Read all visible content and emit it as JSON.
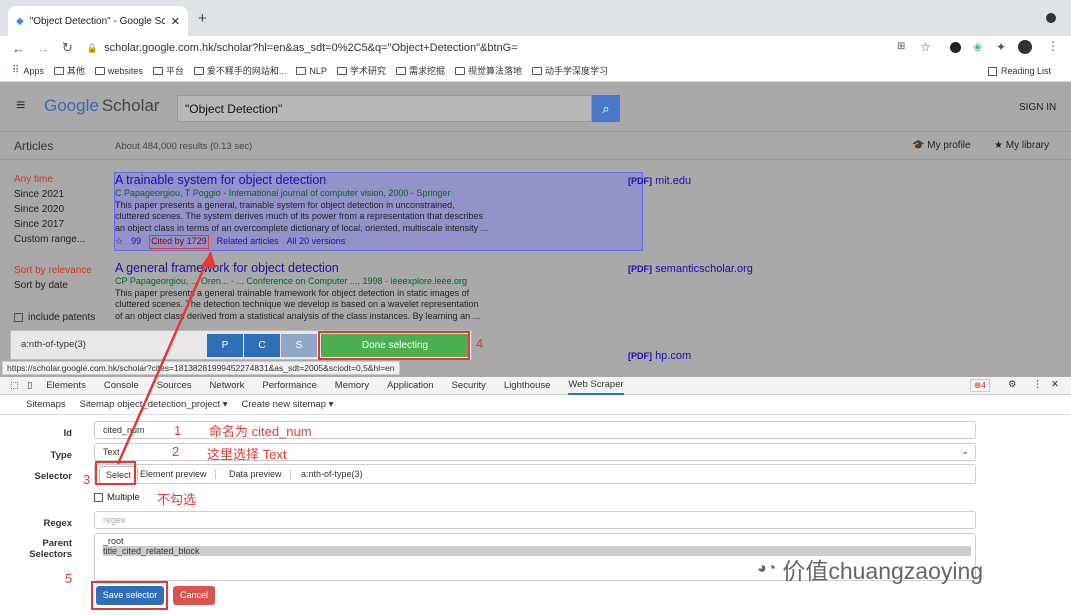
{
  "browser": {
    "tab_title": "\"Object Detection\" - Google Sc",
    "url": "scholar.google.com.hk/scholar?hl=en&as_sdt=0%2C5&q=\"Object+Detection\"&btnG=",
    "bookmarks": [
      "Apps",
      "其他",
      "websites",
      "平台",
      "爱不释手的网站和...",
      "NLP",
      "学术研究",
      "需求挖掘",
      "视觉算法落地",
      "动手学深度学习"
    ],
    "reading_list": "Reading List"
  },
  "scholar": {
    "logo_google": "Google",
    "logo_scholar": "Scholar",
    "query": "\"Object Detection\"",
    "sign_in": "SIGN IN",
    "articles": "Articles",
    "about": "About 484,000 results (0.13 sec)",
    "my_profile": "My profile",
    "my_library": "My library",
    "time_filters": [
      "Any time",
      "Since 2021",
      "Since 2020",
      "Since 2017",
      "Custom range..."
    ],
    "sort": [
      "Sort by relevance",
      "Sort by date"
    ],
    "include_patents": "include patents",
    "results": [
      {
        "title": "A trainable system for object detection",
        "authors": "C Papageorgiou, T Poggio - International journal of computer vision, 2000 - Springer",
        "snippet": [
          "This paper presents a general, trainable system for object detection in unconstrained,",
          "cluttered scenes. The system derives much of its power from a representation that describes",
          "an object class in terms of an overcomplete dictionary of local, oriented, multiscale intensity ..."
        ],
        "cited": "Cited by 1729",
        "related": "Related articles",
        "versions": "All 20 versions",
        "pdf_tag": "[PDF]",
        "pdf_src": "mit.edu"
      },
      {
        "title": "A general framework for object detection",
        "authors": "CP Papageorgiou, ... Oren... - ... Conference on Computer ..., 1998 - ieeexplore.ieee.org",
        "snippet": [
          "This paper presents a general trainable framework for object detection in static images of",
          "cluttered scenes. The detection technique we develop is based on a wavelet representation",
          "of an object class derived from a statistical analysis of the class instances. By learning an ..."
        ],
        "pdf_tag": "[PDF]",
        "pdf_src": "semanticscholar.org"
      }
    ],
    "third_pdf_tag": "[PDF]",
    "third_pdf_src": "hp.com"
  },
  "selector_bar": {
    "selector": "a:nth-of-type(3)",
    "p": "P",
    "c": "C",
    "s": "S",
    "done": "Done selecting"
  },
  "status_url": "https://scholar.google.com.hk/scholar?cites=18138281999452274831&as_sdt=2005&sciodt=0,5&hl=en",
  "devtools": {
    "tabs": [
      "Elements",
      "Console",
      "Sources",
      "Network",
      "Performance",
      "Memory",
      "Application",
      "Security",
      "Lighthouse",
      "Web Scraper"
    ],
    "errors": "4",
    "subnav": [
      "Sitemaps",
      "Sitemap object_detection_project ▾",
      "Create new sitemap ▾"
    ],
    "form": {
      "id_label": "Id",
      "id_value": "cited_num",
      "type_label": "Type",
      "type_value": "Text",
      "selector_label": "Selector",
      "select_btn": "Select",
      "element_preview": "Element preview",
      "data_preview": "Data preview",
      "selector_value": "a:nth-of-type(3)",
      "multiple": "Multiple",
      "regex_label": "Regex",
      "regex_placeholder": "regex",
      "parent_label": "Parent Selectors",
      "parent_options": [
        "_root",
        "title_cited_related_block"
      ],
      "save": "Save selector",
      "cancel": "Cancel"
    }
  },
  "annotations": {
    "n1": "1",
    "t1": "命名为 cited_num",
    "n2": "2",
    "t2": "这里选择 Text",
    "n3": "3",
    "n4": "4",
    "n5": "5",
    "t_multi": "不勾选"
  },
  "watermark": "价值chuangzaoying"
}
